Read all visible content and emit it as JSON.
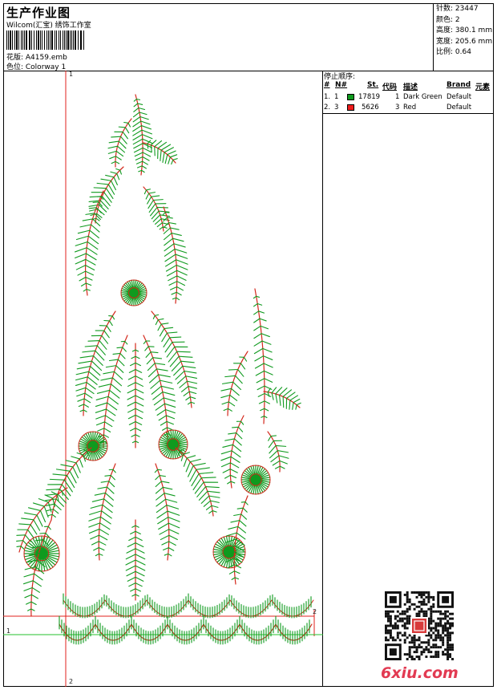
{
  "header": {
    "title": "生产作业图",
    "subtitle": "Wilcom(汇宝) 绣饰工作室",
    "design_line": "花版:  A4159.emb",
    "colorway_line": "色位:  Colorway 1"
  },
  "specs": [
    {
      "label": "针数:",
      "value": "23447"
    },
    {
      "label": "颜色:",
      "value": "2"
    },
    {
      "label": "高度:",
      "value": "380.1 mm"
    },
    {
      "label": "宽度:",
      "value": "205.6 mm"
    },
    {
      "label": "比例:",
      "value": "0.64"
    }
  ],
  "stop_sequence": {
    "title": "停止顺序:",
    "columns": {
      "num": "#",
      "n": "N#",
      "stitches": "St.",
      "code": "代码",
      "desc": "描述",
      "brand": "Brand",
      "element": "元素"
    },
    "rows": [
      {
        "num": "1.",
        "n": "1",
        "color": "#0f9a1e",
        "stitches": "17819",
        "code": "1",
        "desc": "Dark Green",
        "brand": "Default"
      },
      {
        "num": "2.",
        "n": "3",
        "color": "#ee1c1c",
        "stitches": "5626",
        "code": "3",
        "desc": "Red",
        "brand": "Default"
      }
    ]
  },
  "markers": {
    "v_top": "1",
    "v_bottom": "2",
    "h_left": "1",
    "h_right": "2"
  },
  "colors": {
    "green": "#0f9a1e",
    "red": "#d4281c",
    "guide_red": "#e0201c",
    "guide_green": "#24c22e"
  },
  "logo": {
    "text": "6xiu.com"
  }
}
